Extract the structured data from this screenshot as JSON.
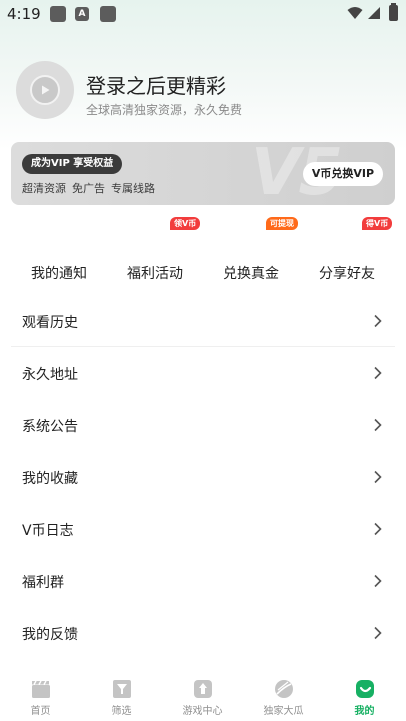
{
  "status_bar": {
    "time": "4:19",
    "app_icons": [
      "app-icon",
      "a-icon",
      "app-icon"
    ]
  },
  "profile": {
    "title": "登录之后更精彩",
    "subtitle": "全球高清独家资源，永久免费"
  },
  "vip_banner": {
    "badge": "成为VIP 享受权益",
    "perks": [
      "超清资源",
      "免广告",
      "专属线路"
    ],
    "button_label": "V币兑换VIP",
    "watermark": "V5"
  },
  "quick_actions": [
    {
      "label": "我的通知",
      "tag": "",
      "icon": "bell-icon"
    },
    {
      "label": "福利活动",
      "tag": "领V币",
      "tag_color": "#f23c3c",
      "icon": "gift-icon"
    },
    {
      "label": "兑换真金",
      "tag": "可提现",
      "tag_color": "#ff6a1a",
      "icon": "coin-icon"
    },
    {
      "label": "分享好友",
      "tag": "得V币",
      "tag_color": "#f23c3c",
      "icon": "share-icon"
    }
  ],
  "menu": [
    "观看历史",
    "永久地址",
    "系统公告",
    "我的收藏",
    "V币日志",
    "福利群",
    "我的反馈"
  ],
  "bottom_nav": [
    {
      "label": "首页",
      "icon": "clapperboard-icon",
      "active": false
    },
    {
      "label": "筛选",
      "icon": "filter-icon",
      "active": false
    },
    {
      "label": "游戏中心",
      "icon": "game-icon",
      "active": false
    },
    {
      "label": "独家大瓜",
      "icon": "melon-icon",
      "active": false
    },
    {
      "label": "我的",
      "icon": "profile-icon",
      "active": true
    }
  ],
  "colors": {
    "accent": "#17b063",
    "tag_red": "#f23c3c",
    "tag_orange": "#ff6a1a"
  }
}
